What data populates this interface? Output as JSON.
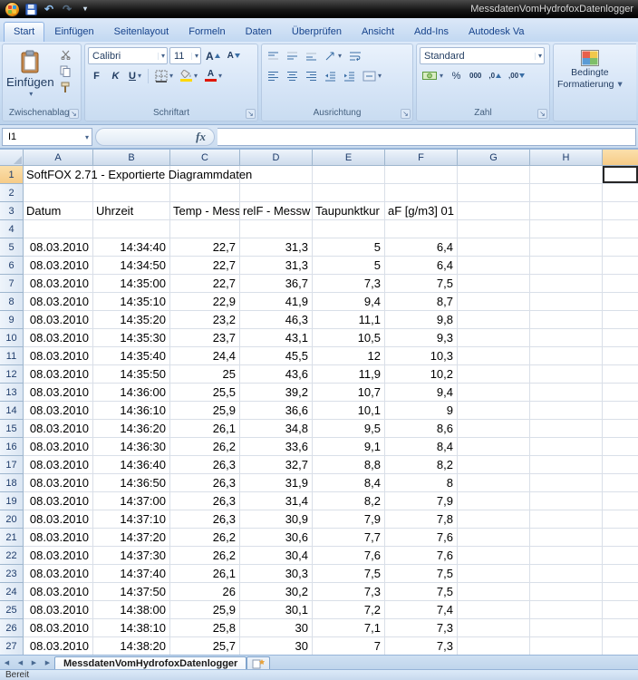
{
  "icons": {
    "dropdown": "▾",
    "undo": "↶",
    "redo": "↷",
    "dialog_launcher": "↘",
    "nav_first": "◀",
    "nav_prev": "◀",
    "nav_next": "▶",
    "nav_last": "▶",
    "fx": "fx",
    "letter_A": "A",
    "inc_decimal": ",0",
    "dec_decimal": ",00"
  },
  "title_bar": {
    "title": "MessdatenVomHydrofoxDatenlogger"
  },
  "ribbon": {
    "tabs": [
      {
        "label": "Start",
        "active": true
      },
      {
        "label": "Einfügen",
        "active": false
      },
      {
        "label": "Seitenlayout",
        "active": false
      },
      {
        "label": "Formeln",
        "active": false
      },
      {
        "label": "Daten",
        "active": false
      },
      {
        "label": "Überprüfen",
        "active": false
      },
      {
        "label": "Ansicht",
        "active": false
      },
      {
        "label": "Add-Ins",
        "active": false
      },
      {
        "label": "Autodesk Va",
        "active": false
      }
    ],
    "clipboard": {
      "label": "Zwischenablage",
      "paste": "Einfügen"
    },
    "font": {
      "label": "Schriftart",
      "family": "Calibri",
      "size": "11",
      "bold": "F",
      "italic": "K",
      "underline": "U"
    },
    "alignment": {
      "label": "Ausrichtung"
    },
    "number": {
      "label": "Zahl",
      "format": "Standard",
      "percent": "%",
      "thousands": "000"
    },
    "styles": {
      "conditional_line1": "Bedingte",
      "conditional_line2": "Formatierung"
    }
  },
  "formula_bar": {
    "name_box": "I1",
    "formula": ""
  },
  "sheet": {
    "selection": "I1",
    "columns": [
      "A",
      "B",
      "C",
      "D",
      "E",
      "F",
      "G",
      "H"
    ],
    "visible_rows": 27,
    "title_cell": {
      "row": 1,
      "text": "SoftFOX 2.71 - Exportierte Diagrammdaten"
    },
    "header_cells": {
      "row": 3,
      "values": [
        "Datum",
        "Uhrzeit",
        "Temp - Mess",
        "relF - Messw",
        "Taupunktkur",
        "aF [g/m3] 01"
      ]
    },
    "data_first_row": 5,
    "data_rows": [
      [
        "08.03.2010",
        "14:34:40",
        "22,7",
        "31,3",
        "5",
        "6,4"
      ],
      [
        "08.03.2010",
        "14:34:50",
        "22,7",
        "31,3",
        "5",
        "6,4"
      ],
      [
        "08.03.2010",
        "14:35:00",
        "22,7",
        "36,7",
        "7,3",
        "7,5"
      ],
      [
        "08.03.2010",
        "14:35:10",
        "22,9",
        "41,9",
        "9,4",
        "8,7"
      ],
      [
        "08.03.2010",
        "14:35:20",
        "23,2",
        "46,3",
        "11,1",
        "9,8"
      ],
      [
        "08.03.2010",
        "14:35:30",
        "23,7",
        "43,1",
        "10,5",
        "9,3"
      ],
      [
        "08.03.2010",
        "14:35:40",
        "24,4",
        "45,5",
        "12",
        "10,3"
      ],
      [
        "08.03.2010",
        "14:35:50",
        "25",
        "43,6",
        "11,9",
        "10,2"
      ],
      [
        "08.03.2010",
        "14:36:00",
        "25,5",
        "39,2",
        "10,7",
        "9,4"
      ],
      [
        "08.03.2010",
        "14:36:10",
        "25,9",
        "36,6",
        "10,1",
        "9"
      ],
      [
        "08.03.2010",
        "14:36:20",
        "26,1",
        "34,8",
        "9,5",
        "8,6"
      ],
      [
        "08.03.2010",
        "14:36:30",
        "26,2",
        "33,6",
        "9,1",
        "8,4"
      ],
      [
        "08.03.2010",
        "14:36:40",
        "26,3",
        "32,7",
        "8,8",
        "8,2"
      ],
      [
        "08.03.2010",
        "14:36:50",
        "26,3",
        "31,9",
        "8,4",
        "8"
      ],
      [
        "08.03.2010",
        "14:37:00",
        "26,3",
        "31,4",
        "8,2",
        "7,9"
      ],
      [
        "08.03.2010",
        "14:37:10",
        "26,3",
        "30,9",
        "7,9",
        "7,8"
      ],
      [
        "08.03.2010",
        "14:37:20",
        "26,2",
        "30,6",
        "7,7",
        "7,6"
      ],
      [
        "08.03.2010",
        "14:37:30",
        "26,2",
        "30,4",
        "7,6",
        "7,6"
      ],
      [
        "08.03.2010",
        "14:37:40",
        "26,1",
        "30,3",
        "7,5",
        "7,5"
      ],
      [
        "08.03.2010",
        "14:37:50",
        "26",
        "30,2",
        "7,3",
        "7,5"
      ],
      [
        "08.03.2010",
        "14:38:00",
        "25,9",
        "30,1",
        "7,2",
        "7,4"
      ],
      [
        "08.03.2010",
        "14:38:10",
        "25,8",
        "30",
        "7,1",
        "7,3"
      ],
      [
        "08.03.2010",
        "14:38:20",
        "25,7",
        "30",
        "7",
        "7,3"
      ]
    ]
  },
  "sheet_tabs": {
    "active": "MessdatenVomHydrofoxDatenlogger"
  },
  "status_bar": {
    "ready": "Bereit"
  }
}
